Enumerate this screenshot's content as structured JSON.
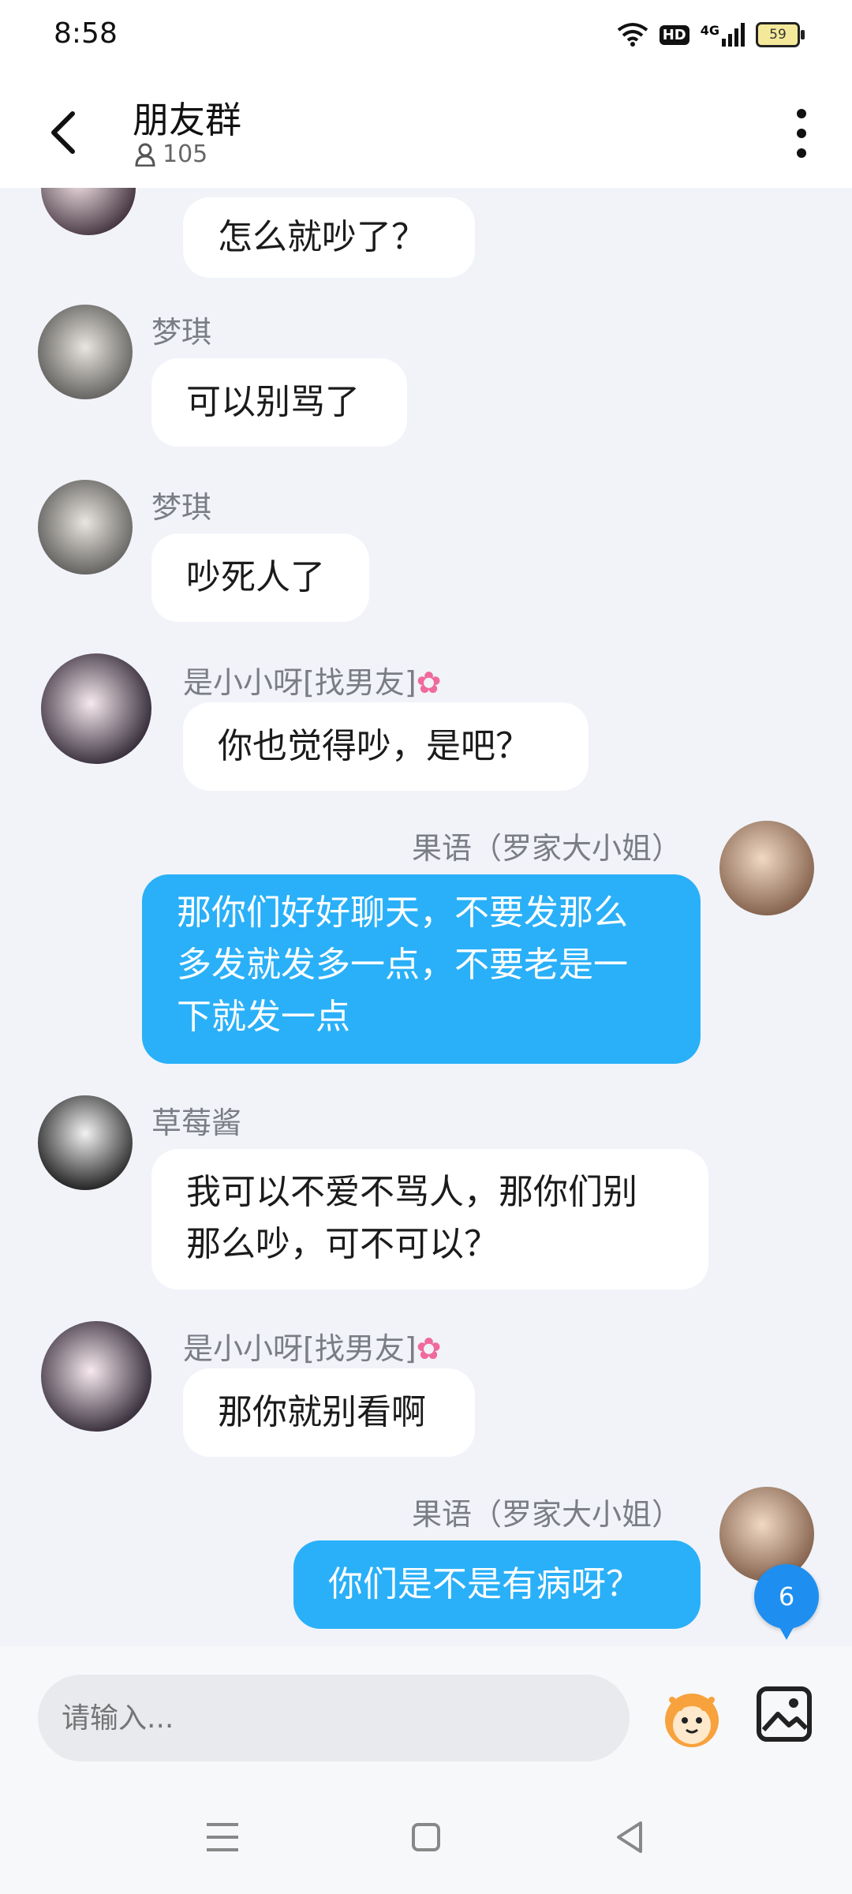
{
  "status_bar": {
    "time": "8:58",
    "hd": "HD",
    "network": "4G",
    "battery": "59"
  },
  "header": {
    "title": "朋友群",
    "member_count": "105"
  },
  "messages": [
    {
      "sender": "",
      "text": "怎么就吵了？"
    },
    {
      "sender": "梦琪",
      "text": "可以别骂了"
    },
    {
      "sender": "梦琪",
      "text": "吵死人了"
    },
    {
      "sender": "是小小呀[找男友]",
      "text": "你也觉得吵，是吧？"
    },
    {
      "sender": "果语（罗家大小姐）",
      "lines": [
        "那你们好好聊天，不要发那么",
        "多发就发多一点，不要老是一",
        "下就发一点"
      ]
    },
    {
      "sender": "草莓酱",
      "lines": [
        "我可以不爱不骂人，那你们别",
        "那么吵，可不可以？"
      ]
    },
    {
      "sender": "是小小呀[找男友]",
      "text": "那你就别看啊"
    },
    {
      "sender": "果语（罗家大小姐）",
      "text": "你们是不是有病呀？"
    }
  ],
  "unread_count": "6",
  "input": {
    "placeholder": "请输入..."
  },
  "colors": {
    "my_bubble": "#2ab0f8",
    "other_bubble": "#ffffff",
    "background": "#f1f3f8",
    "badge": "#1e8ff0"
  }
}
